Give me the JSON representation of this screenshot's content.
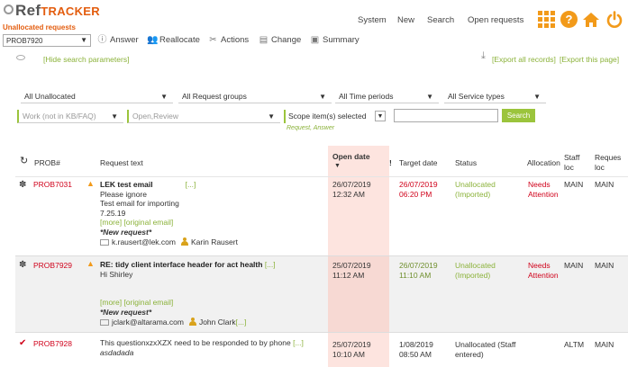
{
  "header": {
    "logo_ref": "Ref",
    "logo_tracker": "TRACKER",
    "subtitle": "Unallocated requests",
    "prob_select": "PROB7920",
    "nav": [
      "System",
      "New",
      "Search",
      "Open requests"
    ],
    "help_icon_label": "?",
    "toolbar": {
      "answer": "Answer",
      "reallocate": "Reallocate",
      "actions": "Actions",
      "change": "Change",
      "summary": "Summary"
    }
  },
  "search_params": {
    "hide_link": "[Hide search parameters]",
    "export_all": "[Export all records]",
    "export_page": "[Export this page]"
  },
  "filters": {
    "allocation": "All Unallocated",
    "request_groups": "All Request groups",
    "time_periods": "All Time periods",
    "service_types": "All Service types",
    "work_type": "Work (not in KB/FAQ)",
    "status": "Open,Review",
    "scope": "Scope item(s) selected",
    "scope_sub": "Request, Answer",
    "search_button": "Search",
    "search_value": ""
  },
  "table": {
    "columns": {
      "prob": "PROB#",
      "request_text": "Request text",
      "open_date": "Open date",
      "target_date": "Target date",
      "status": "Status",
      "allocation": "Allocation",
      "staff_loc_1": "Staff",
      "staff_loc_2": "loc",
      "request_loc_1": "Reques",
      "request_loc_2": "loc"
    },
    "rows": [
      {
        "prob": "PROB7031",
        "title": "LEK test email",
        "title_more": "[...]",
        "lines": [
          "Please ignore",
          "Test email for importing",
          "7.25.19"
        ],
        "links": "[more] [original email]",
        "new_request": "*New request*",
        "email": "k.rausert@lek.com",
        "person": "Karin Rausert",
        "open_date": "26/07/2019",
        "open_time": "12:32 AM",
        "target_date": "26/07/2019",
        "target_time": "06:20 PM",
        "status_1": "Unallocated",
        "status_2": "(Imported)",
        "allocation_1": "Needs",
        "allocation_2": "Attention",
        "staff_loc": "MAIN",
        "request_loc": "MAIN"
      },
      {
        "prob": "PROB7929",
        "title": "RE: tidy client interface header for act health",
        "title_more": "[...]",
        "lines": [
          "Hi Shirley"
        ],
        "links": "[more] [original email]",
        "new_request": "*New request*",
        "email": "jclark@altarama.com",
        "person": "John Clark",
        "person_more": "[...]",
        "open_date": "25/07/2019",
        "open_time": "11:12 AM",
        "target_date": "26/07/2019",
        "target_time": "11:10 AM",
        "status_1": "Unallocated",
        "status_2": "(Imported)",
        "allocation_1": "Needs",
        "allocation_2": "Attention",
        "staff_loc": "MAIN",
        "request_loc": "MAIN"
      },
      {
        "prob": "PROB7928",
        "title": "This questionxzxXZX need to be responded to by phone",
        "title_more": "[...]",
        "lines": [
          "asdadada"
        ],
        "open_date": "25/07/2019",
        "open_time": "10:10 AM",
        "target_date": "1/08/2019",
        "target_time": "08:50 AM",
        "status_1": "Unallocated (Staff",
        "status_2": "entered)",
        "staff_loc": "ALTM",
        "request_loc": "MAIN"
      }
    ]
  },
  "colors": {
    "accent_orange": "#f29a1a",
    "brand_orange": "#e35d0f",
    "link_green": "#8bb23a",
    "alert_red": "#d0021b",
    "open_date_bg": "#fde4df"
  }
}
